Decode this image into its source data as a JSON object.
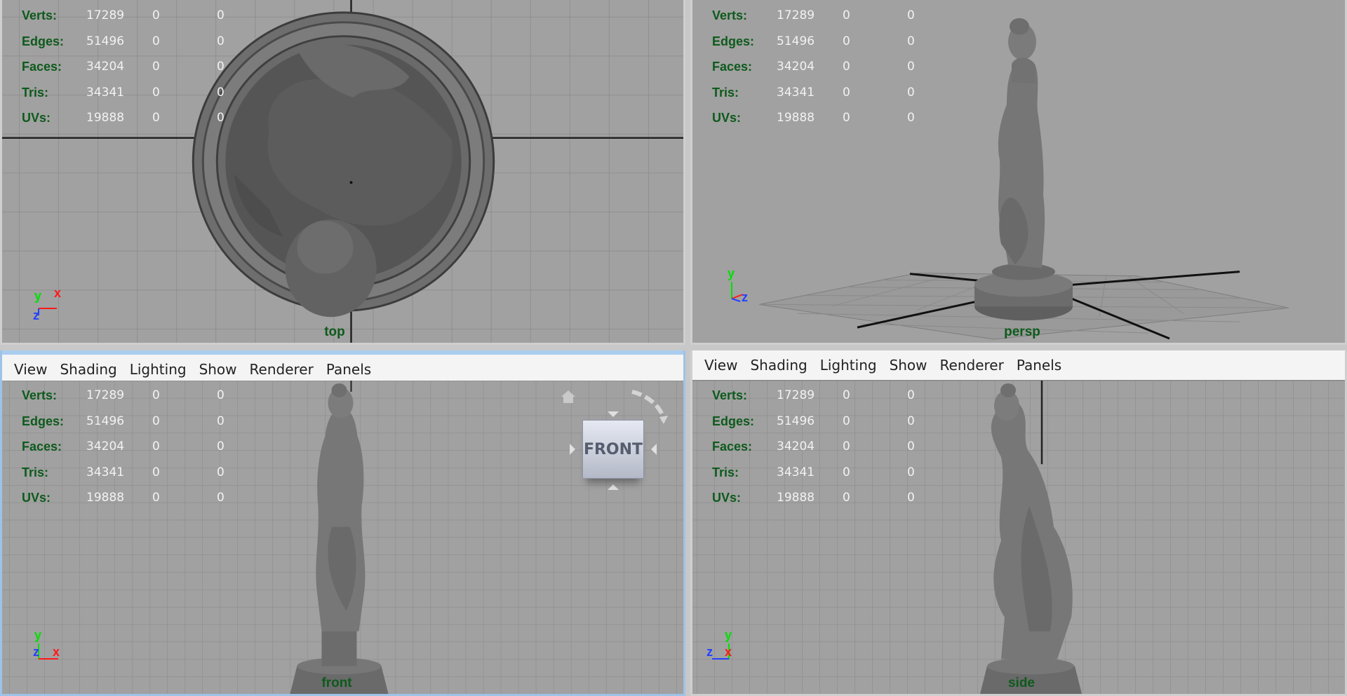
{
  "stats": {
    "rows": [
      {
        "label": "Verts:",
        "v1": "17289",
        "v2": "0",
        "v3": "0"
      },
      {
        "label": "Edges:",
        "v1": "51496",
        "v2": "0",
        "v3": "0"
      },
      {
        "label": "Faces:",
        "v1": "34204",
        "v2": "0",
        "v3": "0"
      },
      {
        "label": "Tris:",
        "v1": "34341",
        "v2": "0",
        "v3": "0"
      },
      {
        "label": "UVs:",
        "v1": "19888",
        "v2": "0",
        "v3": "0"
      }
    ]
  },
  "panel_menu": {
    "view": "View",
    "shading": "Shading",
    "lighting": "Lighting",
    "show": "Show",
    "renderer": "Renderer",
    "panels": "Panels"
  },
  "viewports": {
    "top": {
      "camera": "top"
    },
    "persp": {
      "camera": "persp"
    },
    "front": {
      "camera": "front"
    },
    "side": {
      "camera": "side"
    }
  },
  "axes": {
    "x": "x",
    "y": "y",
    "z": "z"
  },
  "viewcube": {
    "face_label": "FRONT",
    "home_icon": "home-icon"
  },
  "colors": {
    "viewport_bg": "#a1a1a1",
    "grid": "#8a8a8a",
    "hud_label": "#0e5a1c",
    "active_panel_border": "#a9cdef",
    "axis_x": "#ff1a1a",
    "axis_y": "#00e000",
    "axis_z": "#2442ff"
  }
}
